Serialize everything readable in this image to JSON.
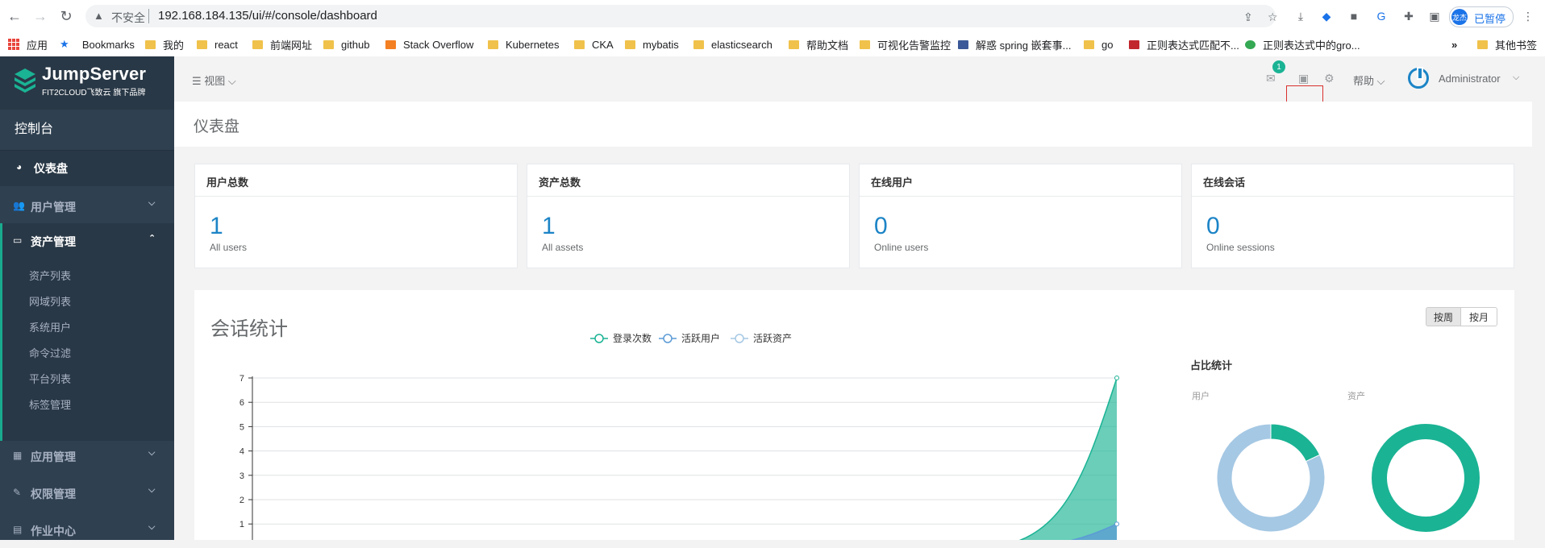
{
  "browser": {
    "security_label": "不安全",
    "url": "192.168.184.135/ui/#/console/dashboard",
    "profile_avatar": "龙杰",
    "profile_label": "已暂停",
    "bookmarks": [
      "应用",
      "Bookmarks",
      "我的",
      "react",
      "前端网址",
      "github",
      "Stack Overflow",
      "Kubernetes",
      "CKA",
      "mybatis",
      "elasticsearch",
      "帮助文档",
      "可视化告警监控",
      "解惑 spring 嵌套事...",
      "go",
      "正则表达式匹配不...",
      "正则表达式中的gro..."
    ],
    "more_bookmarks": "»",
    "other_bookmarks": "其他书签"
  },
  "sidebar": {
    "logo_title": "JumpServer",
    "logo_sub": "FIT2CLOUD飞致云 旗下品牌",
    "console": "控制台",
    "dashboard": "仪表盘",
    "user_mgmt": "用户管理",
    "asset_mgmt": "资产管理",
    "asset_items": [
      "资产列表",
      "网域列表",
      "系统用户",
      "命令过滤",
      "平台列表",
      "标签管理"
    ],
    "app_mgmt": "应用管理",
    "perm_mgmt": "权限管理",
    "ops_center": "作业中心"
  },
  "topbar": {
    "view_menu": "视图",
    "badge_count": "1",
    "help_menu": "帮助",
    "user_name": "Administrator"
  },
  "page": {
    "heading": "仪表盘"
  },
  "stats": [
    {
      "title": "用户总数",
      "value": "1",
      "sub": "All users"
    },
    {
      "title": "资产总数",
      "value": "1",
      "sub": "All assets"
    },
    {
      "title": "在线用户",
      "value": "0",
      "sub": "Online users"
    },
    {
      "title": "在线会话",
      "value": "0",
      "sub": "Online sessions"
    }
  ],
  "session": {
    "title": "会话统计",
    "btn_week": "按周",
    "btn_month": "按月",
    "ratio_title": "占比统计",
    "ratio_user": "用户",
    "ratio_asset": "资产"
  },
  "colors": {
    "sidebar_bg": "#2f4050",
    "accent": "#1ab394",
    "primary_number": "#1c84c6",
    "series_login": "#1ab394",
    "series_active_users": "#5b9bd5",
    "series_active_assets": "#a5c8e4"
  },
  "chart_data": [
    {
      "type": "area",
      "legend": [
        "登录次数",
        "活跃用户",
        "活跃资产"
      ],
      "legend_position": "top-center",
      "ylim": [
        0,
        7
      ],
      "yticks": [
        1,
        2,
        3,
        4,
        5,
        6,
        7
      ],
      "series": [
        {
          "name": "登录次数",
          "values": [
            0,
            0,
            0,
            0,
            0,
            0,
            7
          ]
        },
        {
          "name": "活跃用户",
          "values": [
            0,
            0,
            0,
            0,
            0,
            0,
            1
          ]
        },
        {
          "name": "活跃资产",
          "values": [
            0,
            0,
            0,
            0,
            0,
            0,
            0
          ]
        }
      ],
      "grid": true
    },
    {
      "type": "pie",
      "title": "用户",
      "values": [
        0.18,
        0.82
      ],
      "colors": [
        "#1ab394",
        "#a5c8e4"
      ]
    },
    {
      "type": "pie",
      "title": "资产",
      "values": [
        1.0
      ],
      "colors": [
        "#1ab394"
      ]
    }
  ]
}
